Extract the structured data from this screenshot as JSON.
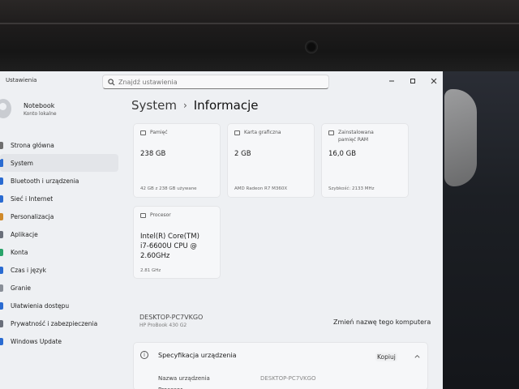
{
  "window": {
    "app_title": "Ustawienia",
    "search_placeholder": "Znajdź ustawienia"
  },
  "profile": {
    "name": "Notebook",
    "account_type": "Konto lokalne"
  },
  "sidebar": {
    "items": [
      {
        "label": "Strona główna",
        "icon": "home-icon",
        "color": "#6f6f6f",
        "active": false
      },
      {
        "label": "System",
        "icon": "monitor-icon",
        "color": "#2a6bd1",
        "active": true
      },
      {
        "label": "Bluetooth i urządzenia",
        "icon": "bluetooth-icon",
        "color": "#2a6bd1",
        "active": false
      },
      {
        "label": "Sieć i Internet",
        "icon": "wifi-icon",
        "color": "#2a6bd1",
        "active": false
      },
      {
        "label": "Personalizacja",
        "icon": "brush-icon",
        "color": "#d08a2a",
        "active": false
      },
      {
        "label": "Aplikacje",
        "icon": "apps-icon",
        "color": "#6a6f7a",
        "active": false
      },
      {
        "label": "Konta",
        "icon": "account-icon",
        "color": "#2aa36a",
        "active": false
      },
      {
        "label": "Czas i język",
        "icon": "clock-icon",
        "color": "#2a6bd1",
        "active": false
      },
      {
        "label": "Granie",
        "icon": "gamepad-icon",
        "color": "#8a8f98",
        "active": false
      },
      {
        "label": "Ułatwienia dostępu",
        "icon": "accessibility-icon",
        "color": "#2a6bd1",
        "active": false
      },
      {
        "label": "Prywatność i zabezpieczenia",
        "icon": "shield-icon",
        "color": "#6a6f7a",
        "active": false
      },
      {
        "label": "Windows Update",
        "icon": "update-icon",
        "color": "#2a6bd1",
        "active": false
      }
    ]
  },
  "breadcrumb": {
    "parent": "System",
    "separator": "›",
    "current": "Informacje"
  },
  "cards": {
    "storage": {
      "label": "Pamięć",
      "value": "238 GB",
      "sub": "42 GB z 238 GB używane"
    },
    "graphics": {
      "label": "Karta graficzna",
      "value": "2 GB",
      "sub": "AMD Radeon R7 M360X"
    },
    "ram": {
      "label": "Zainstalowana pamięć RAM",
      "value": "16,0 GB",
      "sub": "Szybkość: 2133 MHz"
    },
    "cpu": {
      "label": "Procesor",
      "value": "Intel(R) Core(TM) i7-6600U CPU @ 2.60GHz",
      "sub": "2.81 GHz"
    }
  },
  "device": {
    "name": "DESKTOP-PC7VKGO",
    "model": "HP ProBook 430 G2",
    "rename_label": "Zmień nazwę tego komputera"
  },
  "spec": {
    "title": "Specyfikacja urządzenia",
    "copy_label": "Kopiuj",
    "rows": [
      {
        "key": "Nazwa urządzenia",
        "value": "DESKTOP-PC7VKGO"
      },
      {
        "key": "Procesor",
        "value": ""
      }
    ]
  }
}
